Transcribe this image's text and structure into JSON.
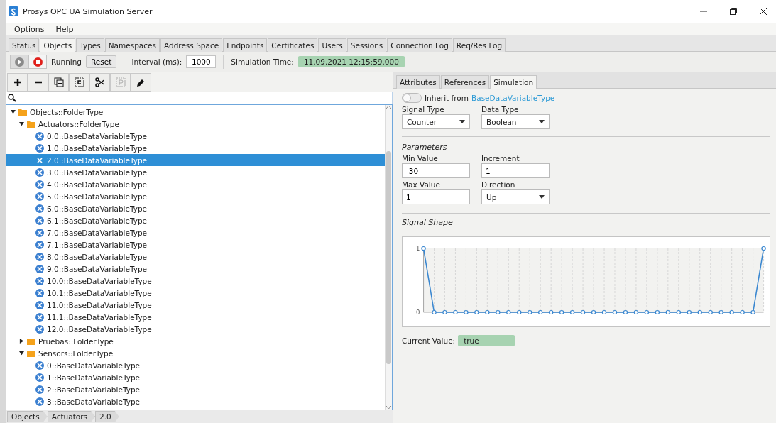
{
  "window": {
    "title": "Prosys OPC UA Simulation Server"
  },
  "menu": [
    "Options",
    "Help"
  ],
  "tabs": [
    {
      "label": "Status",
      "selected": false
    },
    {
      "label": "Objects",
      "selected": true
    },
    {
      "label": "Types",
      "selected": false
    },
    {
      "label": "Namespaces",
      "selected": false
    },
    {
      "label": "Address Space",
      "selected": false
    },
    {
      "label": "Endpoints",
      "selected": false
    },
    {
      "label": "Certificates",
      "selected": false
    },
    {
      "label": "Users",
      "selected": false
    },
    {
      "label": "Sessions",
      "selected": false
    },
    {
      "label": "Connection Log",
      "selected": false
    },
    {
      "label": "Req/Res Log",
      "selected": false
    }
  ],
  "sim_toolbar": {
    "play_disabled": true,
    "status": "Running",
    "reset": "Reset",
    "interval_label": "Interval (ms):",
    "interval": "1000",
    "time_label": "Simulation Time:",
    "time": "11.09.2021 12:15:59.000"
  },
  "tree_toolbar": [
    {
      "kind": "add",
      "disabled": false
    },
    {
      "kind": "remove",
      "disabled": false
    },
    {
      "kind": "duplicate",
      "disabled": false
    },
    {
      "kind": "copy",
      "disabled": false
    },
    {
      "kind": "cut",
      "disabled": false
    },
    {
      "kind": "paste",
      "disabled": true
    },
    {
      "kind": "edit",
      "disabled": false
    }
  ],
  "tree": [
    {
      "label": "Objects::FolderType",
      "kind": "folder",
      "expanded": true,
      "selected": false,
      "children": [
        {
          "label": "Actuators::FolderType",
          "kind": "folder",
          "expanded": true,
          "selected": false,
          "children": [
            {
              "label": "0.0::BaseDataVariableType",
              "kind": "variable",
              "selected": false
            },
            {
              "label": "1.0::BaseDataVariableType",
              "kind": "variable",
              "selected": false
            },
            {
              "label": "2.0::BaseDataVariableType",
              "kind": "variable",
              "selected": true
            },
            {
              "label": "3.0::BaseDataVariableType",
              "kind": "variable",
              "selected": false
            },
            {
              "label": "4.0::BaseDataVariableType",
              "kind": "variable",
              "selected": false
            },
            {
              "label": "5.0::BaseDataVariableType",
              "kind": "variable",
              "selected": false
            },
            {
              "label": "6.0::BaseDataVariableType",
              "kind": "variable",
              "selected": false
            },
            {
              "label": "6.1::BaseDataVariableType",
              "kind": "variable",
              "selected": false
            },
            {
              "label": "7.0::BaseDataVariableType",
              "kind": "variable",
              "selected": false
            },
            {
              "label": "7.1::BaseDataVariableType",
              "kind": "variable",
              "selected": false
            },
            {
              "label": "8.0::BaseDataVariableType",
              "kind": "variable",
              "selected": false
            },
            {
              "label": "9.0::BaseDataVariableType",
              "kind": "variable",
              "selected": false
            },
            {
              "label": "10.0::BaseDataVariableType",
              "kind": "variable",
              "selected": false
            },
            {
              "label": "10.1::BaseDataVariableType",
              "kind": "variable",
              "selected": false
            },
            {
              "label": "11.0::BaseDataVariableType",
              "kind": "variable",
              "selected": false
            },
            {
              "label": "11.1::BaseDataVariableType",
              "kind": "variable",
              "selected": false
            },
            {
              "label": "12.0::BaseDataVariableType",
              "kind": "variable",
              "selected": false
            }
          ]
        },
        {
          "label": "Pruebas::FolderType",
          "kind": "folder",
          "expanded": false,
          "selected": false
        },
        {
          "label": "Sensors::FolderType",
          "kind": "folder",
          "expanded": true,
          "selected": false,
          "children": [
            {
              "label": "0::BaseDataVariableType",
              "kind": "variable",
              "selected": false
            },
            {
              "label": "1::BaseDataVariableType",
              "kind": "variable",
              "selected": false
            },
            {
              "label": "2::BaseDataVariableType",
              "kind": "variable",
              "selected": false
            },
            {
              "label": "3::BaseDataVariableType",
              "kind": "variable",
              "selected": false
            }
          ]
        }
      ]
    }
  ],
  "breadcrumb": [
    "Objects",
    "Actuators",
    "2.0"
  ],
  "detail_tabs": [
    {
      "label": "Attributes",
      "selected": false
    },
    {
      "label": "References",
      "selected": false
    },
    {
      "label": "Simulation",
      "selected": true
    }
  ],
  "simulation": {
    "inherit": {
      "on": false,
      "label": "Inherit from",
      "link": "BaseDataVariableType"
    },
    "signal_type": {
      "label": "Signal Type",
      "value": "Counter"
    },
    "data_type": {
      "label": "Data Type",
      "value": "Boolean"
    },
    "parameters_title": "Parameters",
    "min_value": {
      "label": "Min Value",
      "value": "-30"
    },
    "increment": {
      "label": "Increment",
      "value": "1"
    },
    "max_value": {
      "label": "Max Value",
      "value": "1"
    },
    "direction": {
      "label": "Direction",
      "value": "Up"
    },
    "shape_title": "Signal Shape",
    "chart_data": {
      "type": "line",
      "grid": true,
      "series": [
        {
          "marker": true,
          "color": "#3a87d0",
          "values": [
            1,
            0,
            0,
            0,
            0,
            0,
            0,
            0,
            0,
            0,
            0,
            0,
            0,
            0,
            0,
            0,
            0,
            0,
            0,
            0,
            0,
            0,
            0,
            0,
            0,
            0,
            0,
            0,
            0,
            0,
            0,
            0,
            1
          ]
        }
      ],
      "ylim": [
        0,
        1
      ],
      "yticks": [
        0,
        1
      ]
    },
    "current_label": "Current Value:",
    "current_value": "true"
  }
}
